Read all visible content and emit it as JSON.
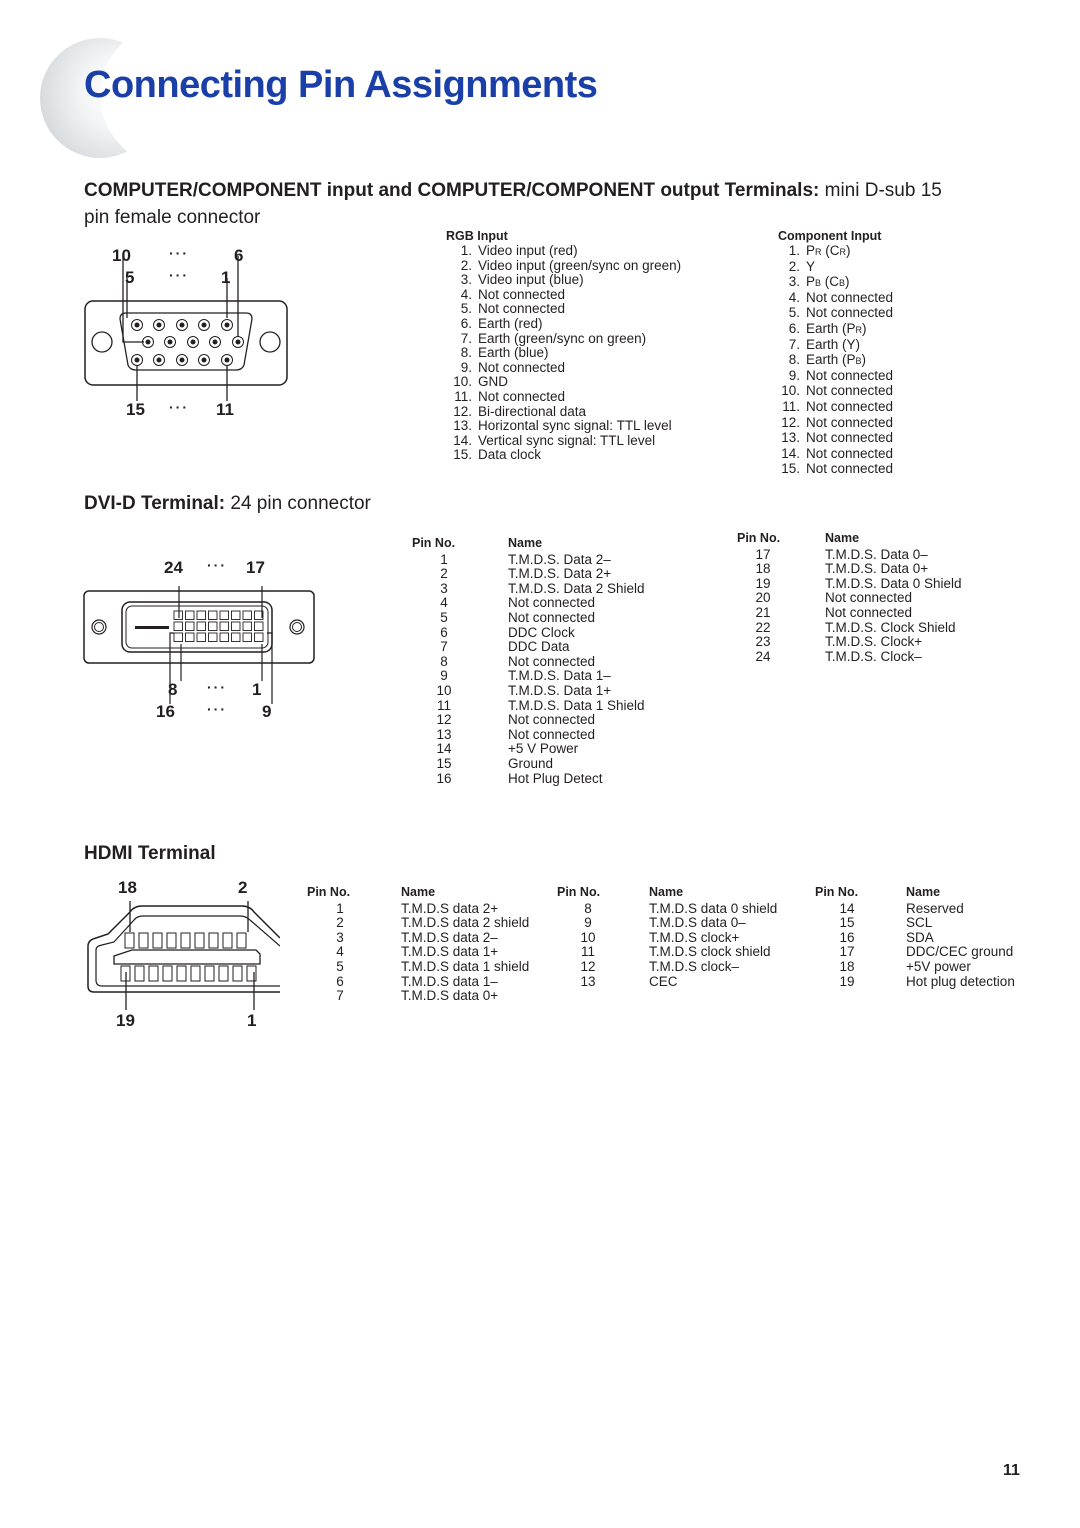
{
  "page": {
    "title": "Connecting Pin Assignments",
    "page_number": "11"
  },
  "vga": {
    "heading_bold": "COMPUTER/COMPONENT input and COMPUTER/COMPONENT output Terminals:",
    "heading_normal": " mini D-sub 15",
    "heading_line2": "pin female connector",
    "labels": {
      "top_left": "10",
      "top_right": "6",
      "mid_left": "5",
      "mid_right": "1",
      "bottom_left": "15",
      "bottom_right": "11",
      "dots": "···"
    },
    "rgb": {
      "title": "RGB Input",
      "items": [
        {
          "n": "1.",
          "t": "Video input (red)"
        },
        {
          "n": "2.",
          "t": "Video input (green/sync on green)"
        },
        {
          "n": "3.",
          "t": "Video input (blue)"
        },
        {
          "n": "4.",
          "t": "Not connected"
        },
        {
          "n": "5.",
          "t": "Not connected"
        },
        {
          "n": "6.",
          "t": "Earth (red)"
        },
        {
          "n": "7.",
          "t": "Earth (green/sync on green)"
        },
        {
          "n": "8.",
          "t": "Earth (blue)"
        },
        {
          "n": "9.",
          "t": "Not connected"
        },
        {
          "n": "10.",
          "t": "GND"
        },
        {
          "n": "11.",
          "t": "Not connected"
        },
        {
          "n": "12.",
          "t": "Bi-directional data"
        },
        {
          "n": "13.",
          "t": "Horizontal sync signal: TTL level"
        },
        {
          "n": "14.",
          "t": "Vertical sync signal: TTL level"
        },
        {
          "n": "15.",
          "t": "Data clock"
        }
      ]
    },
    "component": {
      "title": "Component Input",
      "items": [
        {
          "n": "1.",
          "main": "P",
          "sub": "R",
          "rest": " (C",
          "sub2": "R",
          "end": ")"
        },
        {
          "n": "2.",
          "main": "Y",
          "sub": "",
          "rest": "",
          "sub2": "",
          "end": ""
        },
        {
          "n": "3.",
          "main": "P",
          "sub": "B",
          "rest": " (C",
          "sub2": "B",
          "end": ")"
        },
        {
          "n": "4.",
          "main": "Not connected",
          "sub": "",
          "rest": "",
          "sub2": "",
          "end": ""
        },
        {
          "n": "5.",
          "main": "Not connected",
          "sub": "",
          "rest": "",
          "sub2": "",
          "end": ""
        },
        {
          "n": "6.",
          "main": "Earth (P",
          "sub": "R",
          "rest": ")",
          "sub2": "",
          "end": ""
        },
        {
          "n": "7.",
          "main": "Earth (Y)",
          "sub": "",
          "rest": "",
          "sub2": "",
          "end": ""
        },
        {
          "n": "8.",
          "main": "Earth (P",
          "sub": "B",
          "rest": ")",
          "sub2": "",
          "end": ""
        },
        {
          "n": "9.",
          "main": "Not connected",
          "sub": "",
          "rest": "",
          "sub2": "",
          "end": ""
        },
        {
          "n": "10.",
          "main": "Not connected",
          "sub": "",
          "rest": "",
          "sub2": "",
          "end": ""
        },
        {
          "n": "11.",
          "main": "Not connected",
          "sub": "",
          "rest": "",
          "sub2": "",
          "end": ""
        },
        {
          "n": "12.",
          "main": "Not connected",
          "sub": "",
          "rest": "",
          "sub2": "",
          "end": ""
        },
        {
          "n": "13.",
          "main": "Not connected",
          "sub": "",
          "rest": "",
          "sub2": "",
          "end": ""
        },
        {
          "n": "14.",
          "main": "Not connected",
          "sub": "",
          "rest": "",
          "sub2": "",
          "end": ""
        },
        {
          "n": "15.",
          "main": "Not connected",
          "sub": "",
          "rest": "",
          "sub2": "",
          "end": ""
        }
      ]
    }
  },
  "dvi": {
    "heading_bold": "DVI-D Terminal:",
    "heading_normal": " 24 pin connector",
    "labels": {
      "top_left": "24",
      "top_right": "17",
      "mid_left": "8",
      "mid_right": "1",
      "bottom_left": "16",
      "bottom_right": "9",
      "dots": "···"
    },
    "col_pin": "Pin No.",
    "col_name": "Name",
    "table1": [
      {
        "pin": "1",
        "name": "T.M.D.S. Data 2–"
      },
      {
        "pin": "2",
        "name": "T.M.D.S. Data 2+"
      },
      {
        "pin": "3",
        "name": "T.M.D.S. Data 2 Shield"
      },
      {
        "pin": "4",
        "name": "Not connected"
      },
      {
        "pin": "5",
        "name": "Not connected"
      },
      {
        "pin": "6",
        "name": "DDC Clock"
      },
      {
        "pin": "7",
        "name": "DDC Data"
      },
      {
        "pin": "8",
        "name": "Not connected"
      },
      {
        "pin": "9",
        "name": "T.M.D.S. Data 1–"
      },
      {
        "pin": "10",
        "name": "T.M.D.S. Data 1+"
      },
      {
        "pin": "11",
        "name": "T.M.D.S. Data 1 Shield"
      },
      {
        "pin": "12",
        "name": "Not connected"
      },
      {
        "pin": "13",
        "name": "Not connected"
      },
      {
        "pin": "14",
        "name": "+5 V Power"
      },
      {
        "pin": "15",
        "name": "Ground"
      },
      {
        "pin": "16",
        "name": "Hot Plug Detect"
      }
    ],
    "table2": [
      {
        "pin": "17",
        "name": "T.M.D.S. Data 0–"
      },
      {
        "pin": "18",
        "name": "T.M.D.S. Data 0+"
      },
      {
        "pin": "19",
        "name": "T.M.D.S. Data 0 Shield"
      },
      {
        "pin": "20",
        "name": "Not connected"
      },
      {
        "pin": "21",
        "name": "Not connected"
      },
      {
        "pin": "22",
        "name": "T.M.D.S. Clock Shield"
      },
      {
        "pin": "23",
        "name": "T.M.D.S. Clock+"
      },
      {
        "pin": "24",
        "name": "T.M.D.S. Clock–"
      }
    ]
  },
  "hdmi": {
    "heading": "HDMI Terminal",
    "labels": {
      "top_left": "18",
      "top_right": "2",
      "bottom_left": "19",
      "bottom_right": "1"
    },
    "col_pin": "Pin No.",
    "col_name": "Name",
    "table1": [
      {
        "pin": "1",
        "name": "T.M.D.S data 2+"
      },
      {
        "pin": "2",
        "name": "T.M.D.S data 2 shield"
      },
      {
        "pin": "3",
        "name": "T.M.D.S data 2–"
      },
      {
        "pin": "4",
        "name": "T.M.D.S data 1+"
      },
      {
        "pin": "5",
        "name": "T.M.D.S data 1 shield"
      },
      {
        "pin": "6",
        "name": "T.M.D.S data 1–"
      },
      {
        "pin": "7",
        "name": "T.M.D.S data 0+"
      }
    ],
    "table2": [
      {
        "pin": "8",
        "name": "T.M.D.S data 0 shield"
      },
      {
        "pin": "9",
        "name": "T.M.D.S data 0–"
      },
      {
        "pin": "10",
        "name": "T.M.D.S clock+"
      },
      {
        "pin": "11",
        "name": "T.M.D.S clock shield"
      },
      {
        "pin": "12",
        "name": "T.M.D.S clock–"
      },
      {
        "pin": "13",
        "name": "CEC"
      }
    ],
    "table3": [
      {
        "pin": "14",
        "name": "Reserved"
      },
      {
        "pin": "15",
        "name": "SCL"
      },
      {
        "pin": "16",
        "name": "SDA"
      },
      {
        "pin": "17",
        "name": "DDC/CEC ground"
      },
      {
        "pin": "18",
        "name": "+5V power"
      },
      {
        "pin": "19",
        "name": "Hot plug detection"
      }
    ]
  }
}
